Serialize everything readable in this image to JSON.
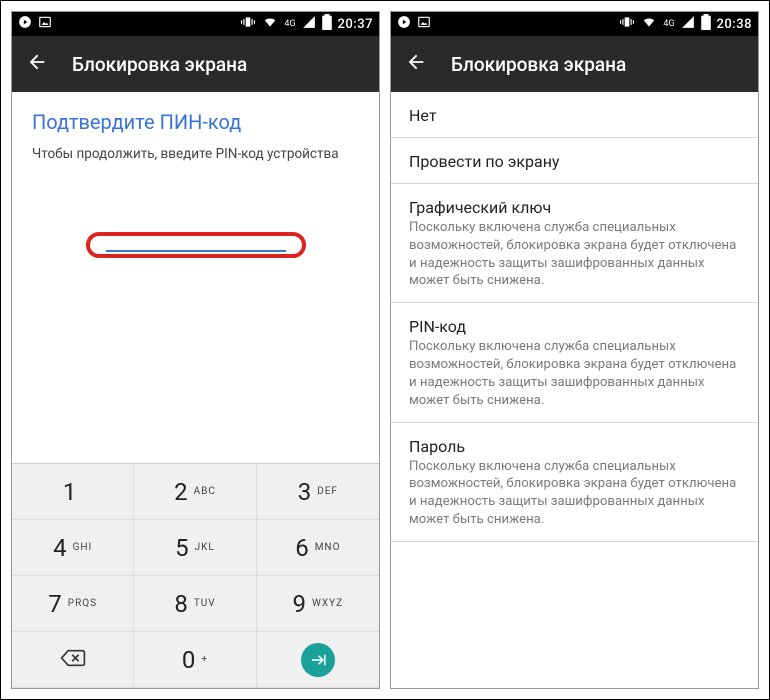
{
  "left": {
    "status": {
      "time": "20:37",
      "network": "4G"
    },
    "appbar": {
      "title": "Блокировка экрана"
    },
    "confirm": {
      "title": "Подтвердите ПИН-код",
      "subtitle": "Чтобы продолжить, введите PIN-код устройства"
    },
    "keypad": {
      "keys": [
        {
          "digit": "1",
          "letters": ""
        },
        {
          "digit": "2",
          "letters": "ABC"
        },
        {
          "digit": "3",
          "letters": "DEF"
        },
        {
          "digit": "4",
          "letters": "GHI"
        },
        {
          "digit": "5",
          "letters": "JKL"
        },
        {
          "digit": "6",
          "letters": "MNO"
        },
        {
          "digit": "7",
          "letters": "PRQS"
        },
        {
          "digit": "8",
          "letters": "TUV"
        },
        {
          "digit": "9",
          "letters": "WXYZ"
        }
      ],
      "zero": "0",
      "plus": "+"
    }
  },
  "right": {
    "status": {
      "time": "20:38",
      "network": "4G"
    },
    "appbar": {
      "title": "Блокировка экрана"
    },
    "options": [
      {
        "title": "Нет",
        "sub": ""
      },
      {
        "title": "Провести по экрану",
        "sub": ""
      },
      {
        "title": "Графический ключ",
        "sub": "Поскольку включена служба специальных возможностей, блокировка экрана будет отключена и надежность защиты зашифрованных данных может быть снижена."
      },
      {
        "title": "PIN-код",
        "sub": "Поскольку включена служба специальных возможностей, блокировка экрана будет отключена и надежность защиты зашифрованных данных может быть снижена."
      },
      {
        "title": "Пароль",
        "sub": "Поскольку включена служба специальных возможностей, блокировка экрана будет отключена и надежность защиты зашифрованных данных может быть снижена."
      }
    ]
  }
}
